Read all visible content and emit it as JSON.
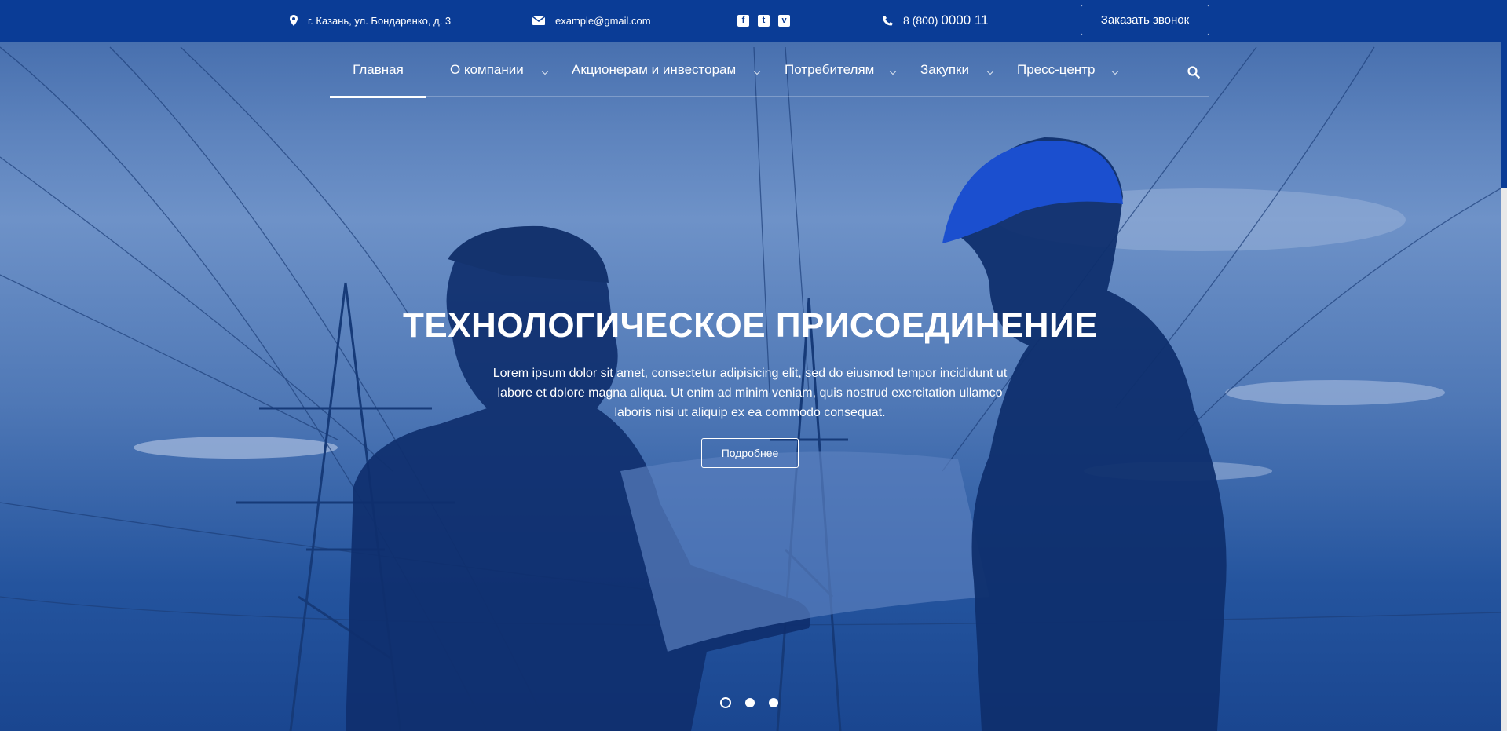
{
  "topbar": {
    "address": "г. Казань, ул. Бондаренко, д. 3",
    "email": "example@gmail.com",
    "social": [
      {
        "icon": "facebook-icon",
        "glyph": "f"
      },
      {
        "icon": "twitter-icon",
        "glyph": "t"
      },
      {
        "icon": "vimeo-icon",
        "glyph": "v"
      }
    ],
    "phone_prefix": "8 (800)",
    "phone_number": "0000 11",
    "callback_label": "Заказать звонок"
  },
  "nav": {
    "items": [
      {
        "label": "Главная",
        "active": true
      },
      {
        "label": "О компании",
        "dropdown": true
      },
      {
        "label": "Акционерам и инвесторам",
        "dropdown": true
      },
      {
        "label": "Потребителям",
        "dropdown": true
      },
      {
        "label": "Закупки",
        "dropdown": true
      },
      {
        "label": "Пресс-центр",
        "dropdown": true
      }
    ]
  },
  "hero": {
    "title": "ТЕХНОЛОГИЧЕСКОЕ ПРИСОЕДИНЕНИЕ",
    "text": "Lorem ipsum dolor sit amet, consectetur adipisicing elit, sed do eiusmod tempor incididunt ut labore et dolore magna aliqua. Ut enim ad minim veniam, quis nostrud exercitation ullamco laboris nisi ut aliquip ex ea commodo consequat.",
    "button_label": "Подробнее",
    "slides_count": 3,
    "active_slide": 1
  },
  "colors": {
    "brand": "#0a3c96",
    "text": "#ffffff"
  }
}
